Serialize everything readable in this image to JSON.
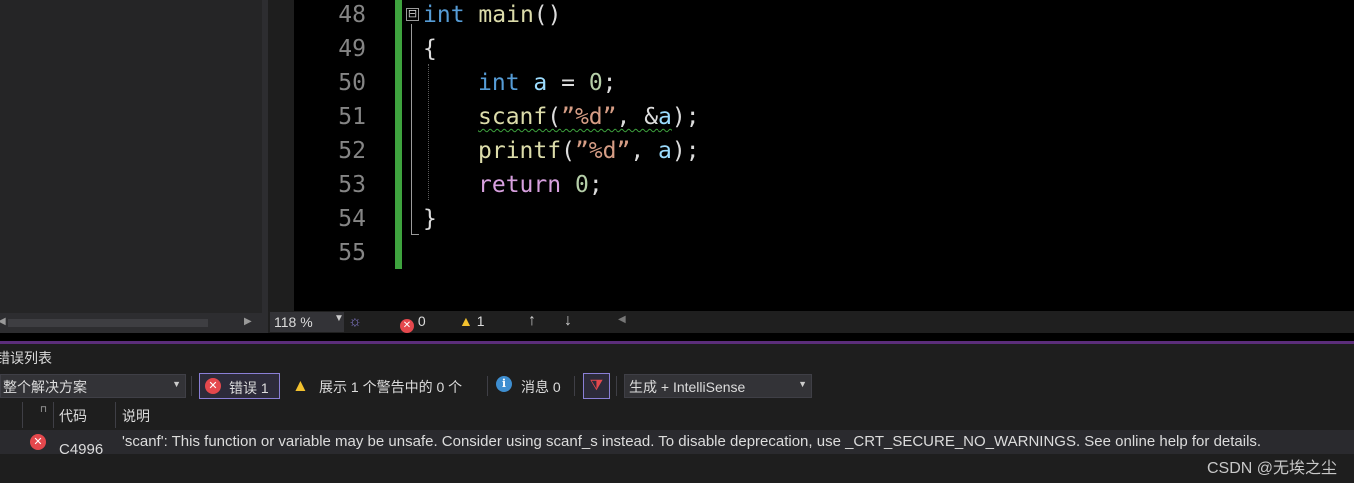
{
  "editor": {
    "lines": [
      {
        "num": "48"
      },
      {
        "num": "49"
      },
      {
        "num": "50"
      },
      {
        "num": "51"
      },
      {
        "num": "52"
      },
      {
        "num": "53"
      },
      {
        "num": "54"
      },
      {
        "num": "55"
      }
    ],
    "tokens": {
      "l48_kw": "int",
      "l48_fn": "main",
      "l48_p": "()",
      "l49": "{",
      "l50_kw": "int",
      "l50_var": "a",
      "l50_eq": " = ",
      "l50_num": "0",
      "l50_end": ";",
      "l51_fn": "scanf",
      "l51_p1": "(",
      "l51_str": "”%d”",
      "l51_comma": ", &",
      "l51_var": "a",
      "l51_end": ");",
      "l52_fn": "printf",
      "l52_p1": "(",
      "l52_str": "”%d”",
      "l52_comma": ", ",
      "l52_var": "a",
      "l52_end": ");",
      "l53_kw": "return",
      "l53_num": "0",
      "l53_end": ";",
      "l54": "}"
    },
    "collapse_glyph": "⊟"
  },
  "status_bar": {
    "zoom": "118 %",
    "error_count": "0",
    "warning_count": "1",
    "nav_up": "↑",
    "nav_down": "↓"
  },
  "error_list": {
    "title": "错误列表",
    "scope": "整个解决方案",
    "errors_label": "错误 1",
    "warnings_label": "展示 1 个警告中的 0 个",
    "messages_label": "消息 0",
    "build_filter": "生成 + IntelliSense",
    "columns": {
      "code": "代码",
      "description": "说明"
    },
    "rows": [
      {
        "code": "C4996",
        "description": "'scanf': This function or variable may be unsafe. Consider using scanf_s instead. To disable deprecation, use _CRT_SECURE_NO_WARNINGS. See online help for details."
      }
    ]
  },
  "watermark": "CSDN @无埃之尘",
  "colors": {
    "keyword": "#569cd6",
    "control_keyword": "#d8a0df",
    "function": "#dcdcaa",
    "variable": "#9cdcfe",
    "number": "#b5cea8",
    "string": "#d69d85",
    "change_bar": "#3ea33e",
    "error": "#e5484d",
    "warning": "#f2c12e",
    "panel_accent": "#5b2d7a"
  }
}
